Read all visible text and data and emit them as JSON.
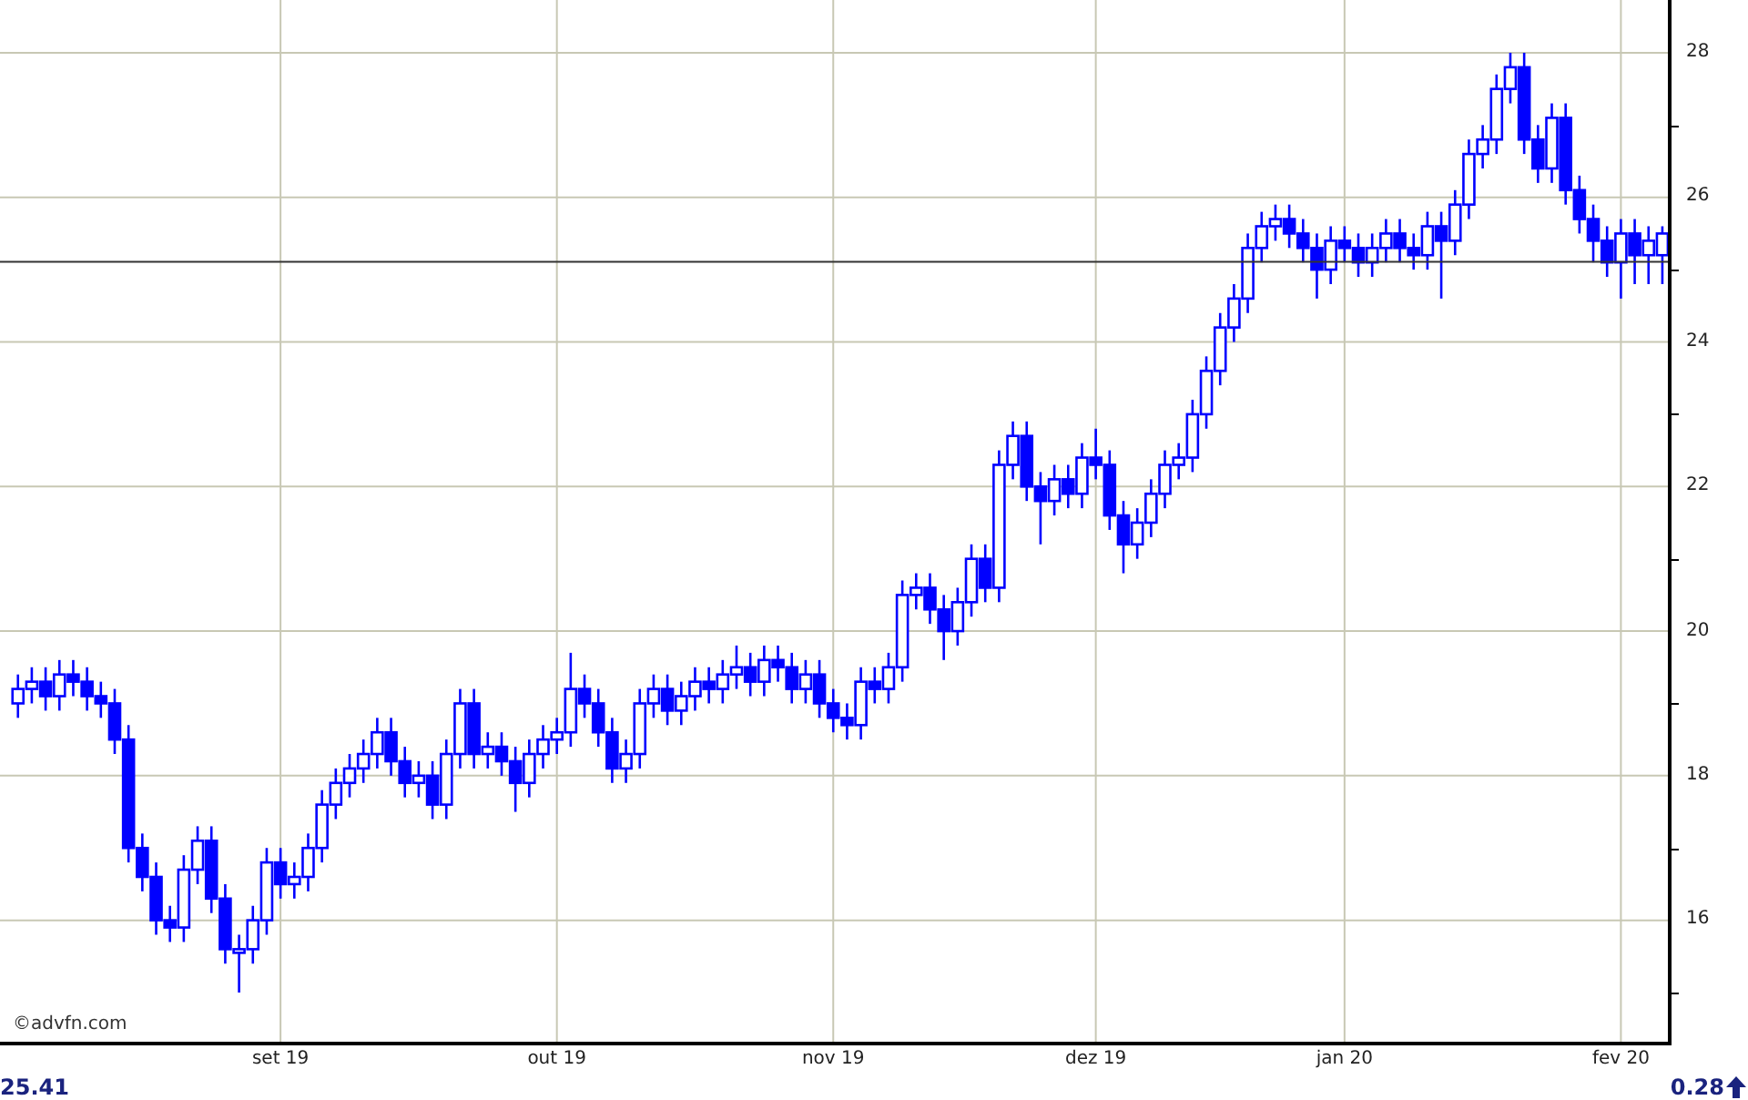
{
  "chart": {
    "credit": "©advfn.com",
    "chart_data": {
      "type": "candlestick",
      "ylim": [
        14.32,
        28.73
      ],
      "yticks": [
        {
          "value": 28,
          "label": "28"
        },
        {
          "value": 26,
          "label": "26"
        },
        {
          "value": 24,
          "label": "24"
        },
        {
          "value": 22,
          "label": "22"
        },
        {
          "value": 20,
          "label": "20"
        },
        {
          "value": 18,
          "label": "18"
        },
        {
          "value": 16,
          "label": "16"
        }
      ],
      "grid": true,
      "ref_lines": [
        {
          "axis": "y",
          "value": 25.11
        }
      ],
      "categories": [
        null,
        null,
        null,
        null,
        null,
        null,
        null,
        null,
        null,
        null,
        null,
        null,
        null,
        null,
        null,
        null,
        null,
        null,
        null,
        "set 19",
        null,
        null,
        null,
        null,
        null,
        null,
        null,
        null,
        null,
        null,
        null,
        null,
        null,
        null,
        null,
        null,
        null,
        null,
        null,
        "out 19",
        null,
        null,
        null,
        null,
        null,
        null,
        null,
        null,
        null,
        null,
        null,
        null,
        null,
        null,
        null,
        null,
        null,
        null,
        null,
        "nov 19",
        null,
        null,
        null,
        null,
        null,
        null,
        null,
        null,
        null,
        null,
        null,
        null,
        null,
        null,
        null,
        null,
        null,
        null,
        "dez 19",
        null,
        null,
        null,
        null,
        null,
        null,
        null,
        null,
        null,
        null,
        null,
        null,
        null,
        null,
        null,
        null,
        null,
        "jan 20",
        null,
        null,
        null,
        null,
        null,
        null,
        null,
        null,
        null,
        null,
        null,
        null,
        null,
        null,
        null,
        null,
        null,
        null,
        null,
        "fev 20",
        null,
        null,
        null
      ],
      "ohlc": [
        [
          19.0,
          19.4,
          18.8,
          19.2
        ],
        [
          19.2,
          19.5,
          19.0,
          19.3
        ],
        [
          19.3,
          19.5,
          18.9,
          19.1
        ],
        [
          19.1,
          19.6,
          18.9,
          19.4
        ],
        [
          19.4,
          19.6,
          19.1,
          19.3
        ],
        [
          19.3,
          19.5,
          18.9,
          19.1
        ],
        [
          19.1,
          19.3,
          18.8,
          19.0
        ],
        [
          19.0,
          19.2,
          18.3,
          18.5
        ],
        [
          18.5,
          18.7,
          16.8,
          17.0
        ],
        [
          17.0,
          17.2,
          16.4,
          16.6
        ],
        [
          16.6,
          16.8,
          15.8,
          16.0
        ],
        [
          16.0,
          16.2,
          15.7,
          15.9
        ],
        [
          15.9,
          16.9,
          15.7,
          16.7
        ],
        [
          16.7,
          17.3,
          16.5,
          17.1
        ],
        [
          17.1,
          17.3,
          16.1,
          16.3
        ],
        [
          16.3,
          16.5,
          15.4,
          15.6
        ],
        [
          15.6,
          15.8,
          15.0,
          15.6
        ],
        [
          15.6,
          16.2,
          15.4,
          16.0
        ],
        [
          16.0,
          17.0,
          15.8,
          16.8
        ],
        [
          16.8,
          17.0,
          16.3,
          16.5
        ],
        [
          16.5,
          16.8,
          16.3,
          16.6
        ],
        [
          16.6,
          17.2,
          16.4,
          17.0
        ],
        [
          17.0,
          17.8,
          16.8,
          17.6
        ],
        [
          17.6,
          18.1,
          17.4,
          17.9
        ],
        [
          17.9,
          18.3,
          17.7,
          18.1
        ],
        [
          18.1,
          18.5,
          17.9,
          18.3
        ],
        [
          18.3,
          18.8,
          18.1,
          18.6
        ],
        [
          18.6,
          18.8,
          18.0,
          18.2
        ],
        [
          18.2,
          18.4,
          17.7,
          17.9
        ],
        [
          17.9,
          18.2,
          17.7,
          18.0
        ],
        [
          18.0,
          18.2,
          17.4,
          17.6
        ],
        [
          17.6,
          18.5,
          17.4,
          18.3
        ],
        [
          18.3,
          19.2,
          18.1,
          19.0
        ],
        [
          19.0,
          19.2,
          18.1,
          18.3
        ],
        [
          18.3,
          18.6,
          18.1,
          18.4
        ],
        [
          18.4,
          18.6,
          18.0,
          18.2
        ],
        [
          18.2,
          18.4,
          17.5,
          17.9
        ],
        [
          17.9,
          18.5,
          17.7,
          18.3
        ],
        [
          18.3,
          18.7,
          18.1,
          18.5
        ],
        [
          18.5,
          18.8,
          18.3,
          18.6
        ],
        [
          18.6,
          19.7,
          18.4,
          19.2
        ],
        [
          19.2,
          19.4,
          18.8,
          19.0
        ],
        [
          19.0,
          19.2,
          18.4,
          18.6
        ],
        [
          18.6,
          18.8,
          17.9,
          18.1
        ],
        [
          18.1,
          18.5,
          17.9,
          18.3
        ],
        [
          18.3,
          19.2,
          18.1,
          19.0
        ],
        [
          19.0,
          19.4,
          18.8,
          19.2
        ],
        [
          19.2,
          19.4,
          18.7,
          18.9
        ],
        [
          18.9,
          19.3,
          18.7,
          19.1
        ],
        [
          19.1,
          19.5,
          18.9,
          19.3
        ],
        [
          19.3,
          19.5,
          19.0,
          19.2
        ],
        [
          19.2,
          19.6,
          19.0,
          19.4
        ],
        [
          19.4,
          19.8,
          19.2,
          19.5
        ],
        [
          19.5,
          19.7,
          19.1,
          19.3
        ],
        [
          19.3,
          19.8,
          19.1,
          19.6
        ],
        [
          19.6,
          19.8,
          19.3,
          19.5
        ],
        [
          19.5,
          19.7,
          19.0,
          19.2
        ],
        [
          19.2,
          19.6,
          19.0,
          19.4
        ],
        [
          19.4,
          19.6,
          18.8,
          19.0
        ],
        [
          19.0,
          19.2,
          18.6,
          18.8
        ],
        [
          18.8,
          19.0,
          18.5,
          18.7
        ],
        [
          18.7,
          19.5,
          18.5,
          19.3
        ],
        [
          19.3,
          19.5,
          19.0,
          19.2
        ],
        [
          19.2,
          19.7,
          19.0,
          19.5
        ],
        [
          19.5,
          20.7,
          19.3,
          20.5
        ],
        [
          20.5,
          20.8,
          20.3,
          20.6
        ],
        [
          20.6,
          20.8,
          20.1,
          20.3
        ],
        [
          20.3,
          20.5,
          19.6,
          20.0
        ],
        [
          20.0,
          20.6,
          19.8,
          20.4
        ],
        [
          20.4,
          21.2,
          20.2,
          21.0
        ],
        [
          21.0,
          21.2,
          20.4,
          20.6
        ],
        [
          20.6,
          22.5,
          20.4,
          22.3
        ],
        [
          22.3,
          22.9,
          22.1,
          22.7
        ],
        [
          22.7,
          22.9,
          21.8,
          22.0
        ],
        [
          22.0,
          22.2,
          21.2,
          21.8
        ],
        [
          21.8,
          22.3,
          21.6,
          22.1
        ],
        [
          22.1,
          22.3,
          21.7,
          21.9
        ],
        [
          21.9,
          22.6,
          21.7,
          22.4
        ],
        [
          22.4,
          22.8,
          22.1,
          22.3
        ],
        [
          22.3,
          22.5,
          21.4,
          21.6
        ],
        [
          21.6,
          21.8,
          20.8,
          21.2
        ],
        [
          21.2,
          21.7,
          21.0,
          21.5
        ],
        [
          21.5,
          22.1,
          21.3,
          21.9
        ],
        [
          21.9,
          22.5,
          21.7,
          22.3
        ],
        [
          22.3,
          22.6,
          22.1,
          22.4
        ],
        [
          22.4,
          23.2,
          22.2,
          23.0
        ],
        [
          23.0,
          23.8,
          22.8,
          23.6
        ],
        [
          23.6,
          24.4,
          23.4,
          24.2
        ],
        [
          24.2,
          24.8,
          24.0,
          24.6
        ],
        [
          24.6,
          25.5,
          24.4,
          25.3
        ],
        [
          25.3,
          25.8,
          25.1,
          25.6
        ],
        [
          25.6,
          25.9,
          25.4,
          25.7
        ],
        [
          25.7,
          25.9,
          25.3,
          25.5
        ],
        [
          25.5,
          25.7,
          25.1,
          25.3
        ],
        [
          25.3,
          25.5,
          24.6,
          25.0
        ],
        [
          25.0,
          25.6,
          24.8,
          25.4
        ],
        [
          25.4,
          25.6,
          25.1,
          25.3
        ],
        [
          25.3,
          25.5,
          24.9,
          25.1
        ],
        [
          25.1,
          25.5,
          24.9,
          25.3
        ],
        [
          25.3,
          25.7,
          25.1,
          25.5
        ],
        [
          25.5,
          25.7,
          25.1,
          25.3
        ],
        [
          25.3,
          25.5,
          25.0,
          25.2
        ],
        [
          25.2,
          25.8,
          25.0,
          25.6
        ],
        [
          25.6,
          25.8,
          24.6,
          25.4
        ],
        [
          25.4,
          26.1,
          25.2,
          25.9
        ],
        [
          25.9,
          26.8,
          25.7,
          26.6
        ],
        [
          26.6,
          27.0,
          26.4,
          26.8
        ],
        [
          26.8,
          27.7,
          26.6,
          27.5
        ],
        [
          27.5,
          28.0,
          27.3,
          27.8
        ],
        [
          27.8,
          28.0,
          26.6,
          26.8
        ],
        [
          26.8,
          27.0,
          26.2,
          26.4
        ],
        [
          26.4,
          27.3,
          26.2,
          27.1
        ],
        [
          27.1,
          27.3,
          25.9,
          26.1
        ],
        [
          26.1,
          26.3,
          25.5,
          25.7
        ],
        [
          25.7,
          25.9,
          25.1,
          25.4
        ],
        [
          25.4,
          25.6,
          24.9,
          25.1
        ],
        [
          25.1,
          25.7,
          24.6,
          25.5
        ],
        [
          25.5,
          25.7,
          24.8,
          25.2
        ],
        [
          25.2,
          25.6,
          24.8,
          25.4
        ],
        [
          25.2,
          25.6,
          24.8,
          25.5
        ]
      ]
    }
  },
  "footer": {
    "last_price": "25.41",
    "change": "0.28",
    "change_up": true
  }
}
